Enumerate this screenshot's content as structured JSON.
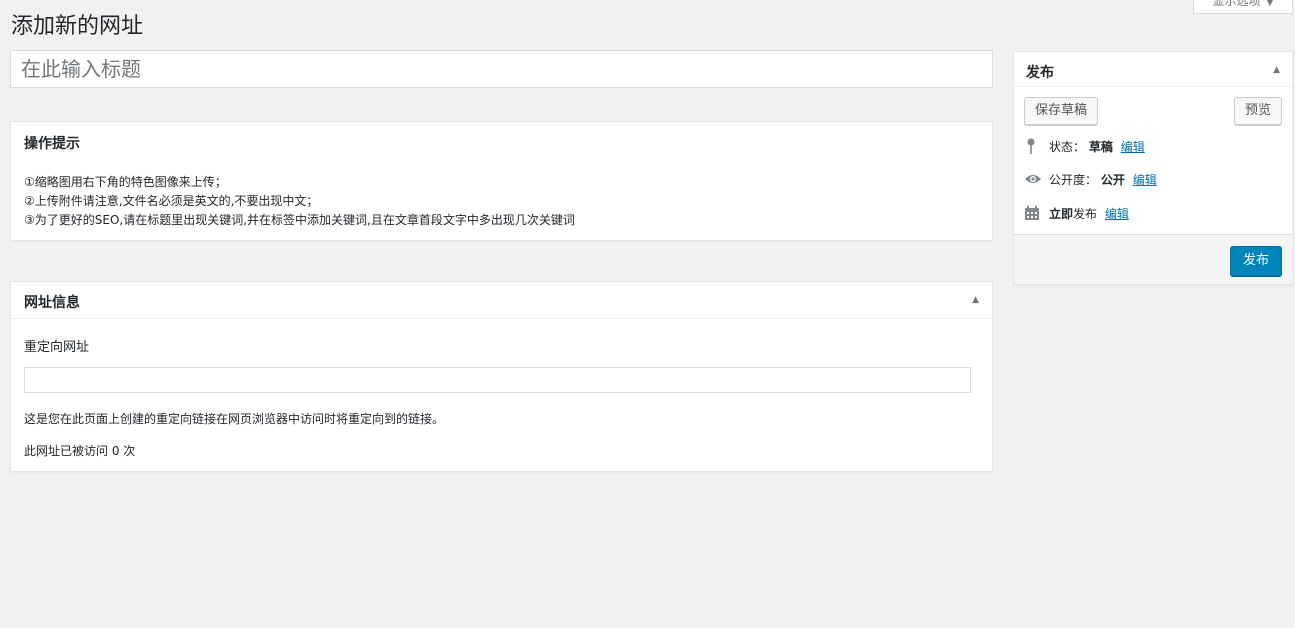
{
  "screen_options": {
    "label": "显示选项"
  },
  "page": {
    "title": "添加新的网址"
  },
  "title_field": {
    "placeholder": "在此输入标题",
    "value": ""
  },
  "notice_box": {
    "title": "操作提示",
    "lines": [
      "①缩略图用右下角的特色图像来上传；",
      "②上传附件请注意,文件名必须是英文的,不要出现中文；",
      "③为了更好的SEO,请在标题里出现关键词,并在标签中添加关键词,且在文章首段文字中多出现几次关键词"
    ]
  },
  "url_box": {
    "title": "网址信息",
    "field_label": "重定向网址",
    "field_value": "",
    "description": "这是您在此页面上创建的重定向链接在网页浏览器中访问时将重定向到的链接。",
    "visit_count": "此网址已被访问 0 次"
  },
  "publish_box": {
    "title": "发布",
    "save_draft_label": "保存草稿",
    "preview_label": "预览",
    "status_label": "状态：",
    "status_value": "草稿",
    "visibility_label": "公开度：",
    "visibility_value": "公开",
    "schedule_bold": "立即",
    "schedule_label": "发布",
    "edit_label": "编辑",
    "publish_label": "发布"
  },
  "icons": [
    "pin-icon",
    "eye-icon",
    "calendar-icon",
    "triangle-up-icon",
    "triangle-down-icon"
  ],
  "colors": {
    "accent": "#0085ba",
    "link": "#0073aa",
    "background": "#f1f1f1"
  }
}
